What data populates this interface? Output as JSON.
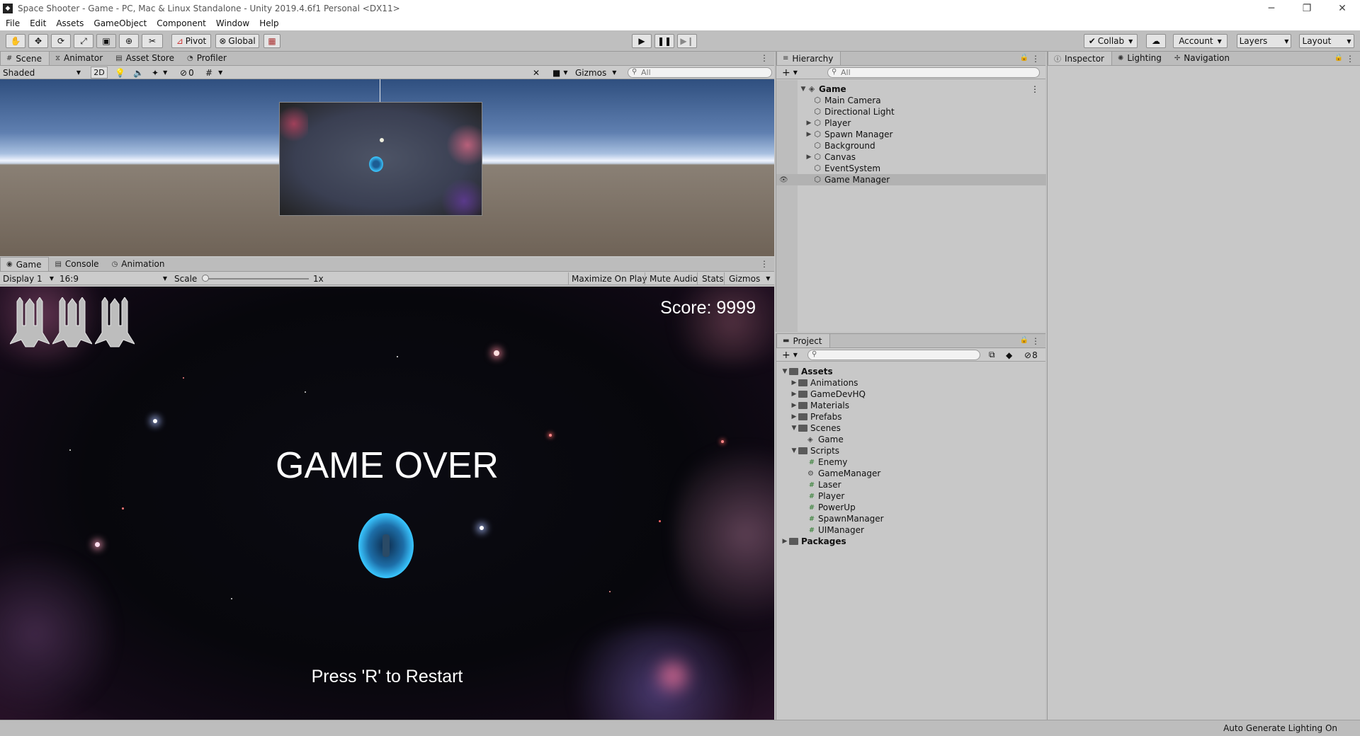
{
  "window": {
    "title": "Space Shooter - Game - PC, Mac & Linux Standalone - Unity 2019.4.6f1 Personal <DX11>",
    "minimize": "─",
    "restore": "❐",
    "close": "✕"
  },
  "menu": [
    "File",
    "Edit",
    "Assets",
    "GameObject",
    "Component",
    "Window",
    "Help"
  ],
  "toolbar": {
    "pivot": "Pivot",
    "global": "Global",
    "collab": "Collab",
    "account": "Account",
    "layers": "Layers",
    "layout": "Layout"
  },
  "scene_panel": {
    "tabs": [
      "Scene",
      "Animator",
      "Asset Store",
      "Profiler"
    ],
    "active_tab": "Scene",
    "shading": "Shaded",
    "mode_2d": "2D",
    "hidden_count": "0",
    "gizmos": "Gizmos",
    "search_placeholder": "All"
  },
  "game_panel": {
    "tabs": [
      "Game",
      "Console",
      "Animation"
    ],
    "active_tab": "Game",
    "display": "Display 1",
    "aspect": "16:9",
    "scale_label": "Scale",
    "scale_value": "1x",
    "maximize_on_play": "Maximize On Play",
    "mute_audio": "Mute Audio",
    "stats": "Stats",
    "gizmos": "Gizmos",
    "score": "Score: 9999",
    "game_over": "GAME OVER",
    "restart": "Press 'R' to Restart",
    "lives": 3
  },
  "hierarchy": {
    "tab": "Hierarchy",
    "search_placeholder": "All",
    "root": "Game",
    "items": [
      {
        "label": "Main Camera",
        "expandable": false
      },
      {
        "label": "Directional Light",
        "expandable": false
      },
      {
        "label": "Player",
        "expandable": true
      },
      {
        "label": "Spawn Manager",
        "expandable": true
      },
      {
        "label": "Background",
        "expandable": false
      },
      {
        "label": "Canvas",
        "expandable": true
      },
      {
        "label": "EventSystem",
        "expandable": false
      },
      {
        "label": "Game Manager",
        "expandable": false,
        "selected": true
      }
    ]
  },
  "project": {
    "tab": "Project",
    "hidden_count": "8",
    "assets_label": "Assets",
    "folders": [
      "Animations",
      "GameDevHQ",
      "Materials",
      "Prefabs"
    ],
    "scenes_label": "Scenes",
    "scenes": [
      "Game"
    ],
    "scripts_label": "Scripts",
    "scripts": [
      "Enemy",
      "GameManager",
      "Laser",
      "Player",
      "PowerUp",
      "SpawnManager",
      "UIManager"
    ],
    "packages_label": "Packages"
  },
  "inspector": {
    "tabs": [
      "Inspector",
      "Lighting",
      "Navigation"
    ],
    "active_tab": "Inspector"
  },
  "status_bar": {
    "text": "Auto Generate Lighting On"
  }
}
